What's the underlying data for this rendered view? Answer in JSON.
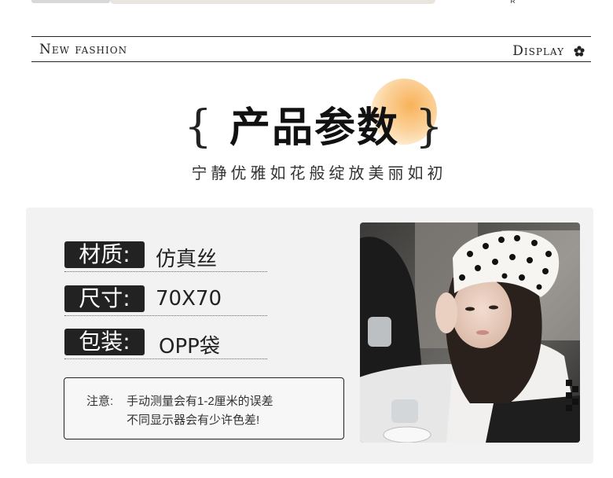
{
  "header": {
    "left_label": "New fashion",
    "right_label": "Display",
    "icon": "flower-icon",
    "top_fragment": "ᴿ"
  },
  "title": {
    "main": "产品参数",
    "brace_open": "{",
    "brace_close": "}",
    "subtitle": "宁静优雅如花般绽放美丽如初",
    "accent_color": "#f8b25a"
  },
  "specs": [
    {
      "label": "材质:",
      "value": "仿真丝"
    },
    {
      "label": "尺寸:",
      "value": "70X70"
    },
    {
      "label": "包装:",
      "value": "OPP袋"
    }
  ],
  "note": {
    "prefix": "注意:",
    "line1": "手动测量会有1-2厘米的误差",
    "line2": "不同显示器会有少许色差!"
  },
  "photo": {
    "subject": "product-photo"
  }
}
